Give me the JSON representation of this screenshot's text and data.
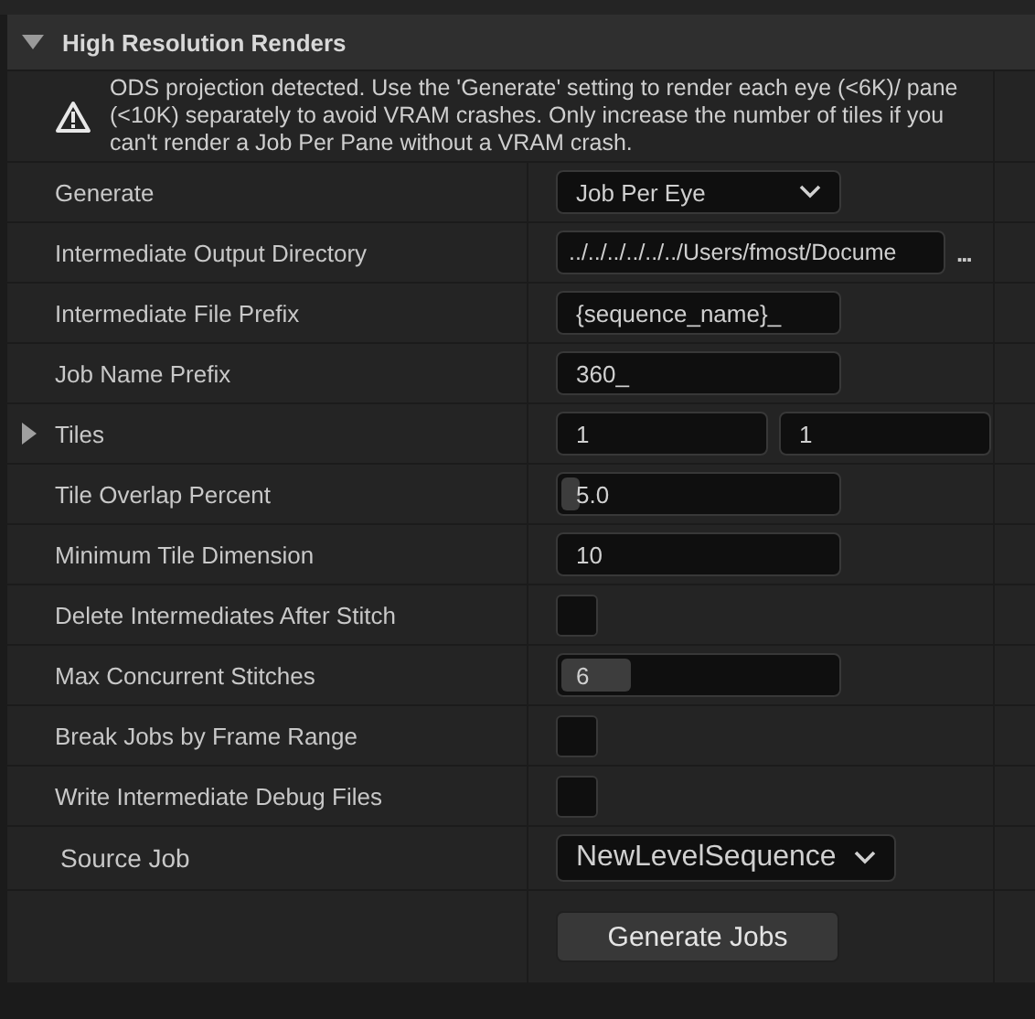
{
  "section": {
    "title": "High Resolution Renders",
    "expanded": true
  },
  "warning": "ODS projection detected. Use the 'Generate' setting to render each eye (<6K)/ pane (<10K) separately to avoid VRAM crashes. Only increase the number of tiles if you can't render a Job Per Pane without a VRAM crash.",
  "properties": [
    {
      "kind": "dropdown",
      "label": "Generate",
      "value": "Job Per Eye"
    },
    {
      "kind": "path",
      "label": "Intermediate Output Directory",
      "value": "../../../../../../Users/fmost/Docume",
      "button": "..."
    },
    {
      "kind": "text",
      "label": "Intermediate File Prefix",
      "value": "{sequence_name}_"
    },
    {
      "kind": "text",
      "label": "Job Name Prefix",
      "value": "360_"
    },
    {
      "kind": "pair",
      "label": "Tiles",
      "expanded": false,
      "values": [
        "1",
        "1"
      ]
    },
    {
      "kind": "slider",
      "label": "Tile Overlap Percent",
      "value": "5.0",
      "level": 0.02
    },
    {
      "kind": "text",
      "label": "Minimum Tile Dimension",
      "value": "10"
    },
    {
      "kind": "checkbox",
      "label": "Delete Intermediates After Stitch",
      "checked": false
    },
    {
      "kind": "slider",
      "label": "Max Concurrent Stitches",
      "value": "6",
      "level": 0.27
    },
    {
      "kind": "checkbox",
      "label": "Break Jobs by Frame Range",
      "checked": false
    },
    {
      "kind": "checkbox",
      "label": "Write Intermediate Debug Files",
      "checked": false
    },
    {
      "kind": "source",
      "label": "Source Job",
      "value": "NewLevelSequence"
    },
    {
      "kind": "button",
      "label": "Generate Jobs"
    }
  ]
}
